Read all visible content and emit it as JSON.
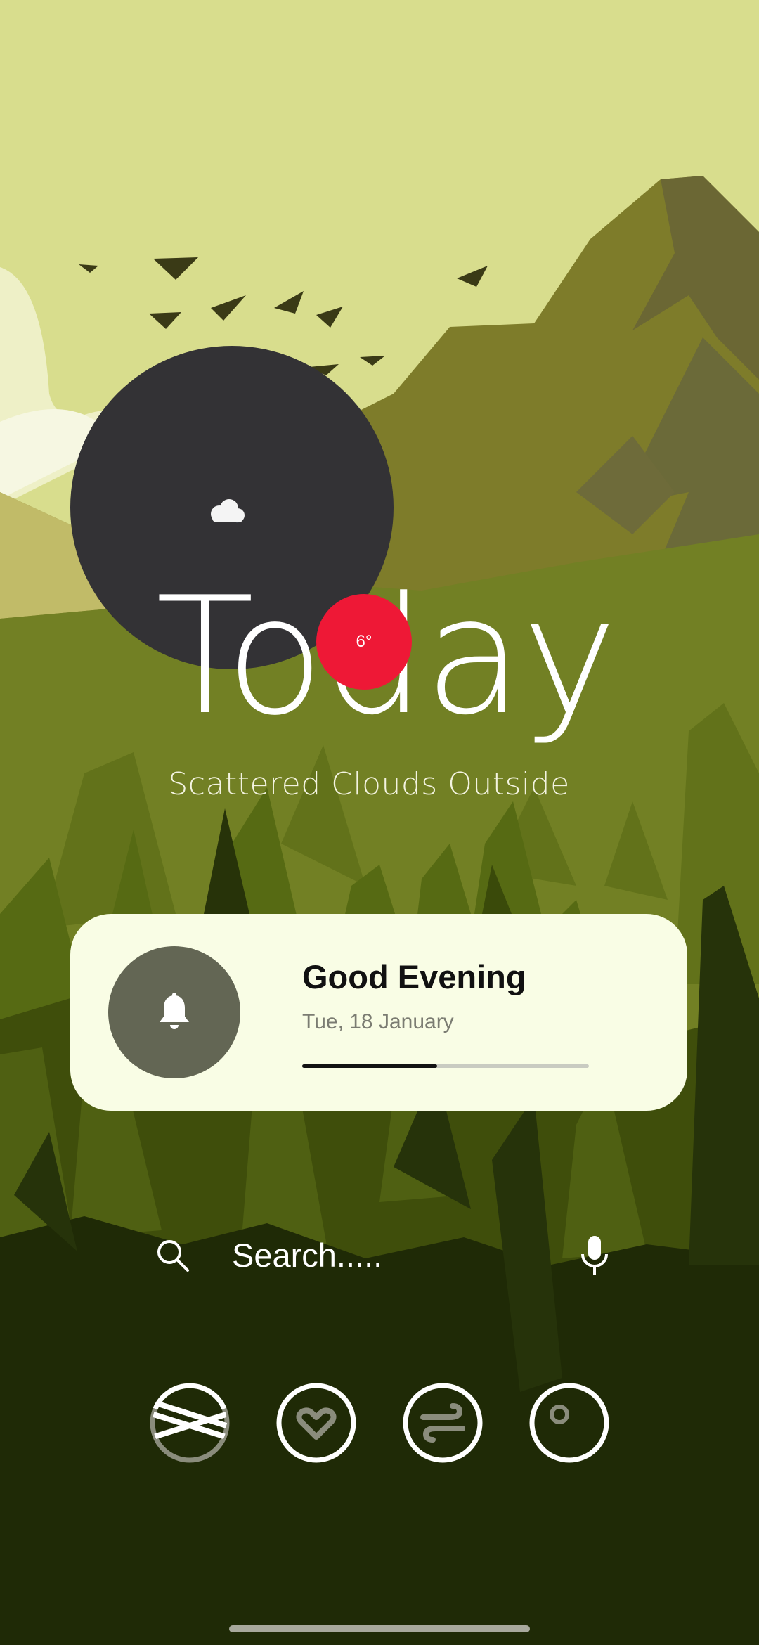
{
  "weather": {
    "condition_icon": "moon-cloud-icon",
    "headline": "Today",
    "temperature": "6°",
    "description": "Scattered Clouds Outside"
  },
  "greeting": {
    "icon": "bell-icon",
    "title": "Good Evening",
    "date": "Tue, 18 January",
    "progress": 0.47
  },
  "search": {
    "placeholder": "Search.....",
    "search_icon": "search-icon",
    "mic_icon": "microphone-icon"
  },
  "dock": {
    "apps": [
      {
        "icon": "crossed-bands-icon"
      },
      {
        "icon": "heart-icon"
      },
      {
        "icon": "wind-icon"
      },
      {
        "icon": "dot-circle-icon"
      }
    ]
  },
  "colors": {
    "sky": "#d8dd8d",
    "weather_circle": "#333235",
    "temperature_badge": "#ee1836",
    "card": "#f9fde5",
    "bell_circle": "#636654",
    "forest_dark": "#1f2a06"
  }
}
